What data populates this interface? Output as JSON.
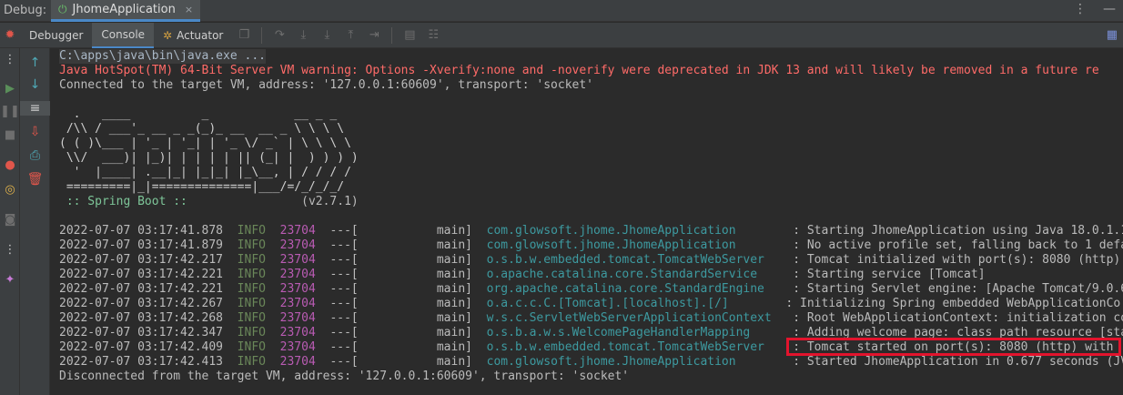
{
  "titlebar": {
    "debug_label": "Debug:",
    "run_tab": "JhomeApplication",
    "close_glyph": "×"
  },
  "toolbar": {
    "tabs": [
      {
        "label": "Debugger"
      },
      {
        "label": "Console"
      },
      {
        "label": "Actuator"
      }
    ]
  },
  "console": {
    "cmd": "C:\\apps\\java\\bin\\java.exe ...",
    "warning": "Java HotSpot(TM) 64-Bit Server VM warning: Options -Xverify:none and -noverify were deprecated in JDK 13 and will likely be removed in a future re",
    "connected": "Connected to the target VM, address: '127.0.0.1:60609', transport: 'socket'",
    "banner": [
      "  .   ____          _            __ _ _",
      " /\\\\ / ___'_ __ _ _(_)_ __  __ _ \\ \\ \\ \\",
      "( ( )\\___ | '_ | '_| | '_ \\/ _` | \\ \\ \\ \\",
      " \\\\/  ___)| |_)| | | | | || (_| |  ) ) ) )",
      "  '  |____| .__|_| |_|_| |_\\__, | / / / /",
      " =========|_|==============|___/=/_/_/_/"
    ],
    "boot_label": " :: Spring Boot :: ",
    "boot_version": "               (v2.7.1)",
    "log_lines": [
      {
        "ts": "2022-07-07 03:17:41.878",
        "level": "INFO",
        "pid": "23704",
        "thread": "---[           main]",
        "logger": "com.glowsoft.jhome.JhomeApplication      ",
        "msg": "  : Starting JhomeApplication using Java 18.0.1.1"
      },
      {
        "ts": "2022-07-07 03:17:41.879",
        "level": "INFO",
        "pid": "23704",
        "thread": "---[           main]",
        "logger": "com.glowsoft.jhome.JhomeApplication      ",
        "msg": "  : No active profile set, falling back to 1 defa"
      },
      {
        "ts": "2022-07-07 03:17:42.217",
        "level": "INFO",
        "pid": "23704",
        "thread": "---[           main]",
        "logger": "o.s.b.w.embedded.tomcat.TomcatWebServer  ",
        "msg": "  : Tomcat initialized with port(s): 8080 (http)"
      },
      {
        "ts": "2022-07-07 03:17:42.221",
        "level": "INFO",
        "pid": "23704",
        "thread": "---[           main]",
        "logger": "o.apache.catalina.core.StandardService   ",
        "msg": "  : Starting service [Tomcat]"
      },
      {
        "ts": "2022-07-07 03:17:42.221",
        "level": "INFO",
        "pid": "23704",
        "thread": "---[           main]",
        "logger": "org.apache.catalina.core.StandardEngine  ",
        "msg": "  : Starting Servlet engine: [Apache Tomcat/9.0.6"
      },
      {
        "ts": "2022-07-07 03:17:42.267",
        "level": "INFO",
        "pid": "23704",
        "thread": "---[           main]",
        "logger": "o.a.c.c.C.[Tomcat].[localhost].[/]      ",
        "msg": "  : Initializing Spring embedded WebApplicationCo"
      },
      {
        "ts": "2022-07-07 03:17:42.268",
        "level": "INFO",
        "pid": "23704",
        "thread": "---[           main]",
        "logger": "w.s.c.ServletWebServerApplicationContext ",
        "msg": "  : Root WebApplicationContext: initialization co"
      },
      {
        "ts": "2022-07-07 03:17:42.347",
        "level": "INFO",
        "pid": "23704",
        "thread": "---[           main]",
        "logger": "o.s.b.a.w.s.WelcomePageHandlerMapping    ",
        "msg": "  : Adding welcome page: class path resource [sta"
      },
      {
        "ts": "2022-07-07 03:17:42.409",
        "level": "INFO",
        "pid": "23704",
        "thread": "---[           main]",
        "logger": "o.s.b.w.embedded.tomcat.TomcatWebServer  ",
        "msg": "  : Tomcat started on port(s): 8080 (http) with"
      },
      {
        "ts": "2022-07-07 03:17:42.413",
        "level": "INFO",
        "pid": "23704",
        "thread": "---[           main]",
        "logger": "com.glowsoft.jhome.JhomeApplication      ",
        "msg": "  : Started JhomeApplication in 0.677 seconds (JV"
      }
    ],
    "disconnected": "Disconnected from the target VM, address: '127.0.0.1:60609', transport: 'socket'"
  },
  "colors": {
    "warning": "#ff6b68",
    "info": "#6a8759",
    "pid": "#b95bb3",
    "logger": "#3d9aa0",
    "highlight": "#e3142d"
  }
}
